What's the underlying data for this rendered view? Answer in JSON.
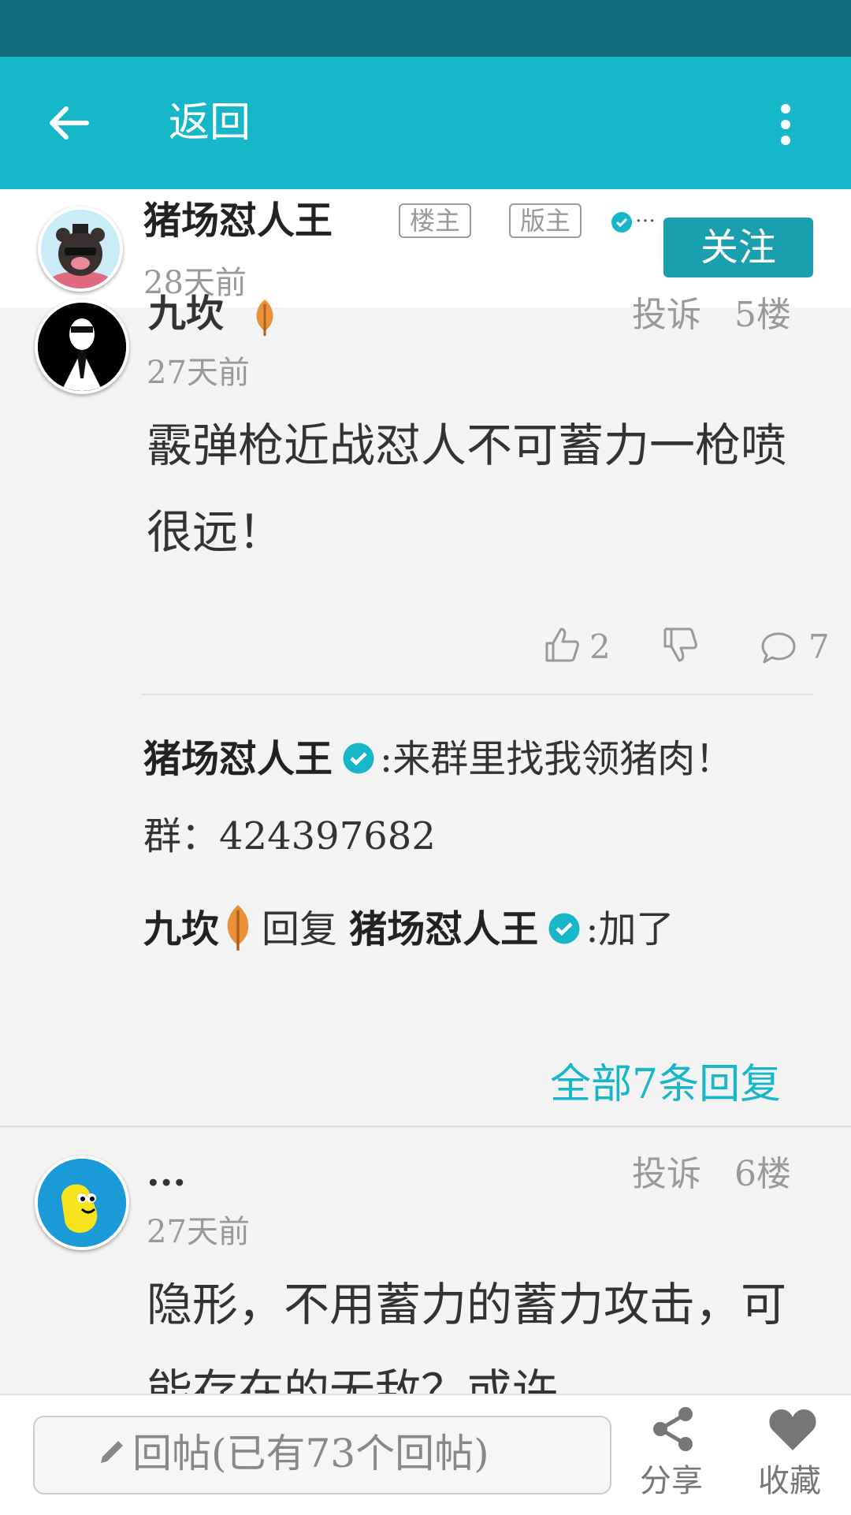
{
  "header": {
    "back_label": "返回"
  },
  "op": {
    "name": "猪场怼人王",
    "tag_op": "楼主",
    "tag_mod": "版主",
    "more": "…",
    "time": "28天前",
    "follow_label": "关注"
  },
  "floor5": {
    "name": "九坎",
    "report": "投诉",
    "floor": "5楼",
    "time": "27天前",
    "content": "霰弹枪近战怼人不可蓄力一枪喷很远！",
    "likes": "2",
    "comments": "7",
    "replies": [
      {
        "author": "猪场怼人王",
        "text": ":来群里找我领猪肉！ 群：424397682"
      },
      {
        "author": "九坎",
        "reply_word": "回复",
        "target": "猪场怼人王",
        "text": ":加了"
      }
    ],
    "all_replies": "全部7条回复"
  },
  "floor6": {
    "name": "...",
    "report": "投诉",
    "floor": "6楼",
    "time": "27天前",
    "content": "隐形，不用蓄力的蓄力攻击，可能存在的无敌？或许"
  },
  "bottom": {
    "reply_placeholder": "回帖(已有73个回帖)",
    "share_label": "分享",
    "collect_label": "收藏"
  },
  "colors": {
    "accent": "#15b7c9",
    "status_bar": "#136d7c",
    "follow": "#1a9fae"
  }
}
